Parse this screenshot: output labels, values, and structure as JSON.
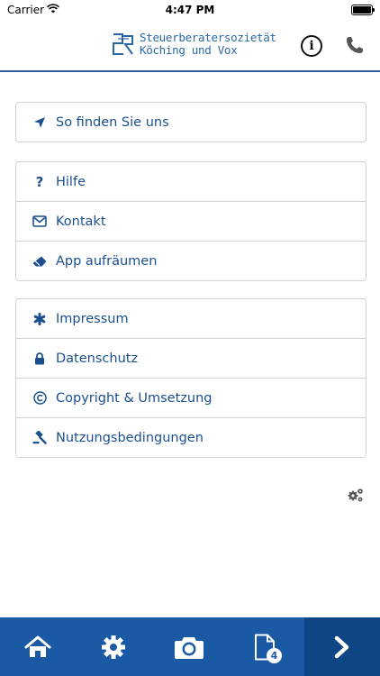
{
  "status_bar": {
    "carrier": "Carrier",
    "time": "4:47 PM"
  },
  "header": {
    "logo_line1": "Steuerberatersozietät",
    "logo_line2": "Köching und Vox",
    "info_label": "i"
  },
  "menu": {
    "group1": [
      {
        "label": "So finden Sie uns",
        "icon": "location-arrow-icon"
      }
    ],
    "group2": [
      {
        "label": "Hilfe",
        "icon": "question-icon"
      },
      {
        "label": "Kontakt",
        "icon": "envelope-icon"
      },
      {
        "label": "App aufräumen",
        "icon": "eraser-icon"
      }
    ],
    "group3": [
      {
        "label": "Impressum",
        "icon": "asterisk-icon"
      },
      {
        "label": "Datenschutz",
        "icon": "lock-icon"
      },
      {
        "label": "Copyright & Umsetzung",
        "icon": "copyright-icon"
      },
      {
        "label": "Nutzungsbedingungen",
        "icon": "gavel-icon"
      }
    ]
  },
  "tabbar": {
    "items": [
      {
        "name": "home",
        "icon": "home-icon"
      },
      {
        "name": "settings",
        "icon": "gear-icon"
      },
      {
        "name": "camera",
        "icon": "camera-icon"
      },
      {
        "name": "documents",
        "icon": "document-icon",
        "badge": "4"
      },
      {
        "name": "next",
        "icon": "chevron-right-icon",
        "active": true
      }
    ]
  },
  "colors": {
    "primary": "#1c4f8f",
    "tabbar": "#1a5aa5",
    "tabbar_active": "#0e4585"
  }
}
